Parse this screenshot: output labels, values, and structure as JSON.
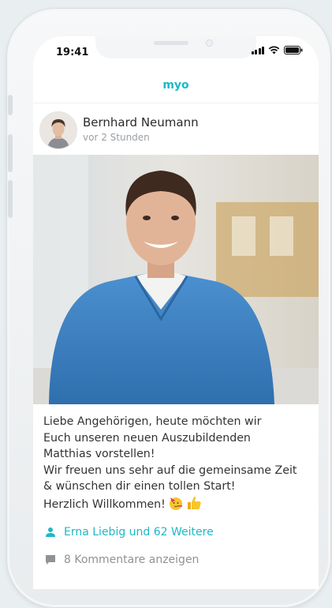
{
  "status": {
    "time": "19:41"
  },
  "app": {
    "name": "myo"
  },
  "post": {
    "author": "Bernhard Neumann",
    "time_ago": "vor 2 Stunden",
    "lines": [
      "Liebe Angehörigen, heute möchten wir",
      "Euch unseren neuen Auszubildenden",
      "Matthias vorstellen!",
      "Wir freuen uns sehr auf die gemeinsame Zeit",
      "& wünschen dir einen tollen Start!",
      "Herzlich Willkommen!"
    ],
    "emojis": [
      "party-face-icon",
      "thumbs-up-icon"
    ],
    "likes": "Erna Liebig und 62 Weitere",
    "comments": "8 Kommentare anzeigen"
  },
  "colors": {
    "accent": "#1fb8c8",
    "scrubs": "#3f86c8"
  }
}
